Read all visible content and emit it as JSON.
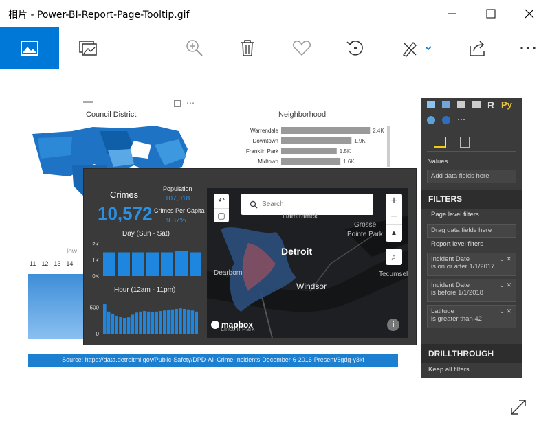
{
  "window": {
    "title": "相片 - Power-BI-Report-Page-Tooltip.gif"
  },
  "toolbar": {
    "icons": [
      "photo-icon",
      "slideshow-icon",
      "zoom-icon",
      "delete-icon",
      "favorite-icon",
      "rotate-icon",
      "edit-icon",
      "share-icon",
      "more-icon"
    ],
    "accent": "#0078d7"
  },
  "report": {
    "council_title": "Council District",
    "neighborhood_title": "Neighborhood",
    "neighborhoods": [
      {
        "name": "Warrendale",
        "value_label": "2.4K",
        "value": 2.4
      },
      {
        "name": "Downtown",
        "value_label": "1.9K",
        "value": 1.9
      },
      {
        "name": "Franklin Park",
        "value_label": "1.5K",
        "value": 1.5
      },
      {
        "name": "Midtown",
        "value_label": "1.6K",
        "value": 1.6
      }
    ],
    "day_numbers": [
      "11",
      "12",
      "13",
      "14"
    ],
    "low_label": "low",
    "source": "Source: https://data.detroitmi.gov/Public-Safety/DPD-All-Crime-Incidents-December-6-2016-Present/6gdg-y3kf"
  },
  "tooltip": {
    "crimes_label": "Crimes",
    "crimes_value": "10,572",
    "population_label": "Population",
    "population_value": "107,018",
    "per_capita_label": "Crimes Per Capita",
    "per_capita_value": "9.87%",
    "day_chart_title": "Day (Sun - Sat)",
    "day_axis": [
      "2K",
      "1K",
      "0K"
    ],
    "day_values": [
      1.5,
      1.5,
      1.5,
      1.5,
      1.5,
      1.6,
      1.5
    ],
    "hour_chart_title": "Hour (12am - 11pm)",
    "hour_axis": [
      "500",
      "0"
    ],
    "hour_values": [
      560,
      420,
      380,
      340,
      320,
      300,
      310,
      360,
      400,
      420,
      430,
      420,
      410,
      420,
      430,
      440,
      450,
      460,
      470,
      480,
      470,
      460,
      440,
      420
    ],
    "map": {
      "search_placeholder": "Search",
      "city": "Detroit",
      "labels": [
        "Hamtramck",
        "Grosse",
        "Pointe Park",
        "Dearborn",
        "Windsor",
        "Tecumseh",
        "Lincoln Park"
      ],
      "brand": "mapbox"
    }
  },
  "panes": {
    "values_label": "Values",
    "values_placeholder": "Add data fields here",
    "filters_label": "FILTERS",
    "page_filters": "Page level filters",
    "drag_fields": "Drag data fields here",
    "report_filters": "Report level filters",
    "filters": [
      {
        "field": "Incident Date",
        "condition": "is on or after 1/1/2017"
      },
      {
        "field": "Incident Date",
        "condition": "is before 1/1/2018"
      },
      {
        "field": "Latitude",
        "condition": "is greater than 42"
      }
    ],
    "drillthrough_label": "DRILLTHROUGH",
    "keep_all_filters": "Keep all filters",
    "viz_letters": [
      "R",
      "Py"
    ]
  }
}
